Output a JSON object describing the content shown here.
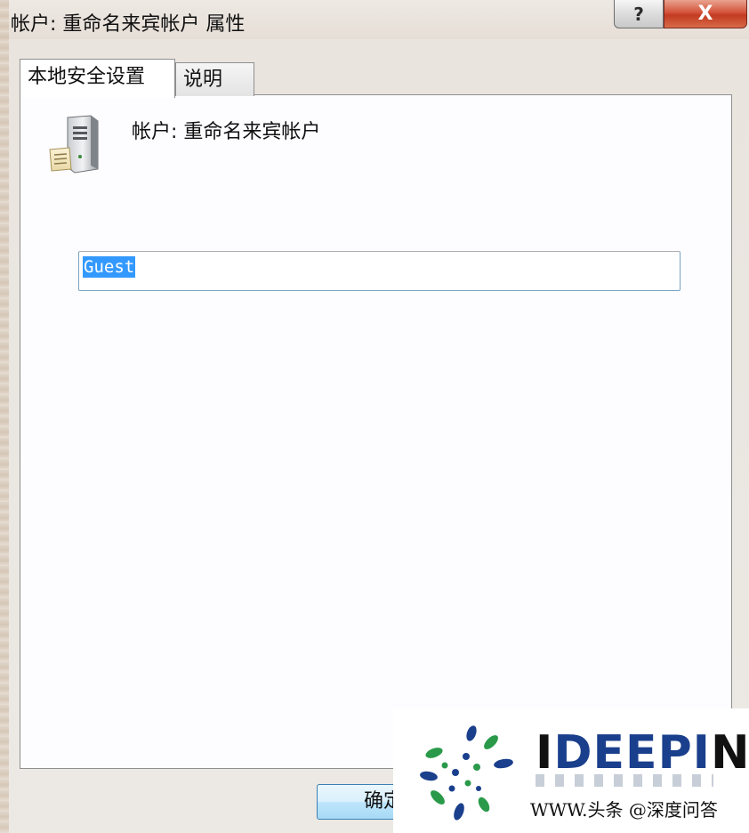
{
  "window": {
    "title": "帐户: 重命名来宾帐户 属性",
    "help_label": "?",
    "close_label": "X"
  },
  "tabs": [
    {
      "label": "本地安全设置",
      "active": true
    },
    {
      "label": "说明",
      "active": false
    }
  ],
  "panel": {
    "icon": "server-policy-icon",
    "account_label": "帐户: 重命名来宾帐户",
    "input_value": "Guest"
  },
  "buttons": {
    "ok_label": "确定"
  },
  "watermark": {
    "brand_prefix": "I",
    "brand_main": "DEEPI",
    "brand_suffix": "N",
    "credit": "WWW.头条 @深度问答"
  },
  "colors": {
    "selection": "#3399ff",
    "close_button": "#c23b22",
    "brand": "#1a3f8c"
  }
}
